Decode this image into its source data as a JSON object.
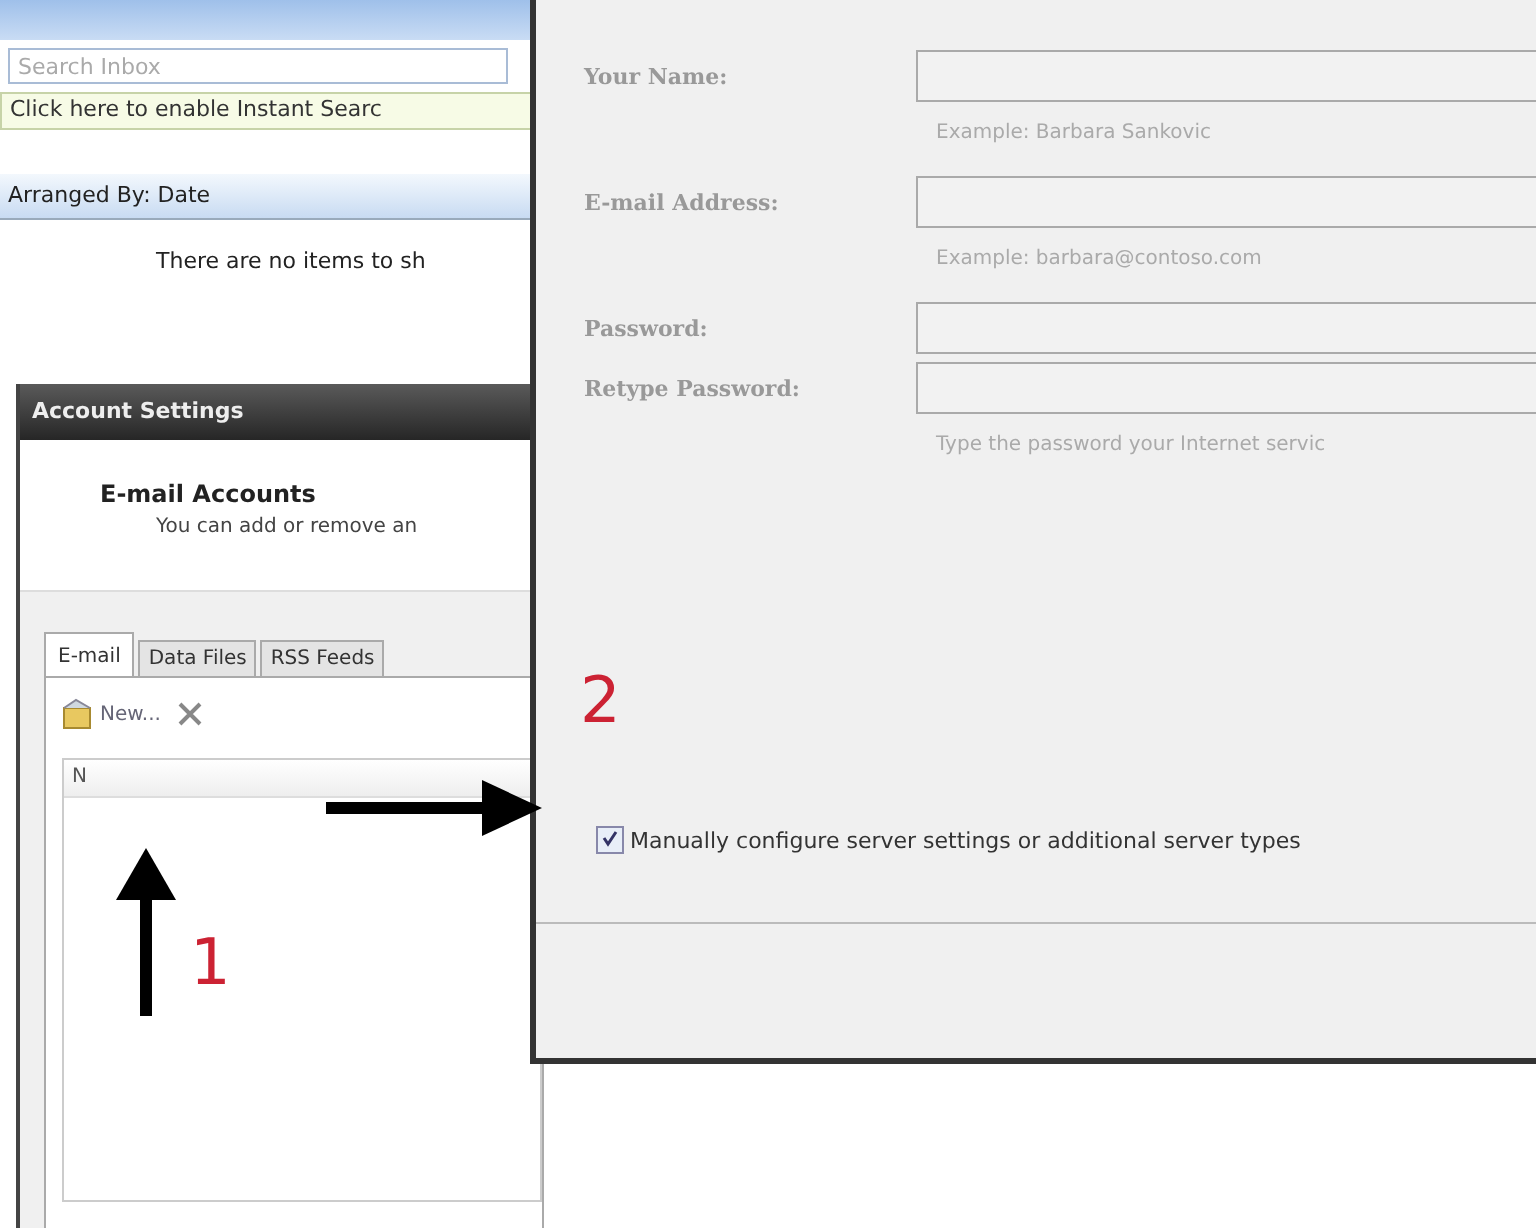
{
  "inbox": {
    "search": {
      "placeholder": "Search Inbox"
    },
    "instant_search_bar": "Click here to enable Instant Searc",
    "arranged_by": "Arranged By: Date",
    "empty_message": "There are no items to sh"
  },
  "account_settings": {
    "title": "Account Settings",
    "heading": "E-mail Accounts",
    "description": "You can add or remove an",
    "tabs": [
      {
        "label": "E-mail",
        "selected": true
      },
      {
        "label": "Data Files",
        "selected": false
      },
      {
        "label": "RSS Feeds",
        "selected": false
      }
    ],
    "new_button": "New...",
    "columns": [
      "N"
    ]
  },
  "dialog": {
    "fields": [
      {
        "label": "Your Name:",
        "hint": "Example: Barbara Sankovic"
      },
      {
        "label": "E-mail Address:",
        "hint": "Example: barbara@contoso.com"
      },
      {
        "label": "Password:"
      },
      {
        "label": "Retype Password:",
        "hint": "Type the password your Internet servic"
      }
    ],
    "checkbox": {
      "label": "Manually configure server settings or additional server types",
      "checked": true
    }
  },
  "steps": [
    "1",
    "2"
  ]
}
